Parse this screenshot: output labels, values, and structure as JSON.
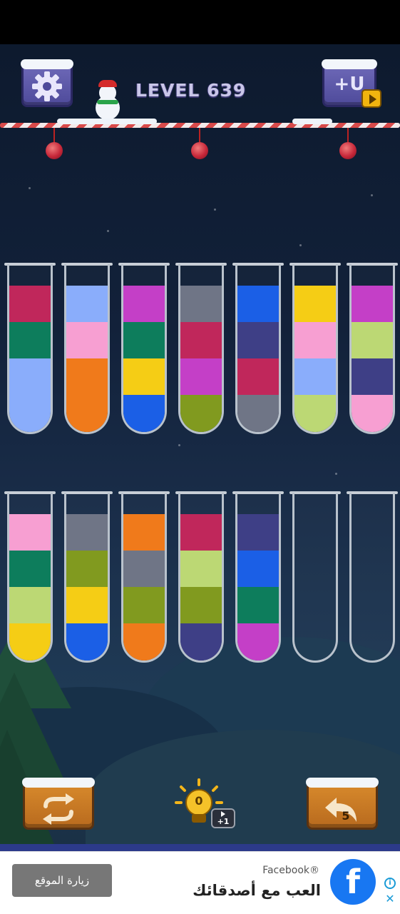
{
  "header": {
    "level_label": "LEVEL 639",
    "settings_icon": "gear-icon",
    "add_tube_icon": "add-tube-icon",
    "add_tube_label": "+U",
    "video_ad_icon": "play-icon"
  },
  "colors": {
    "crimson": "#c0275b",
    "teal": "#0d7d5c",
    "light_blue": "#8aadfb",
    "pink": "#f79fd2",
    "orange": "#f07a1b",
    "magenta": "#c43fc7",
    "yellow": "#f5cd15",
    "blue": "#1b5fe6",
    "gray": "#6f7586",
    "olive": "#819a1f",
    "navy": "#3e3f86",
    "lime": "#bcd874"
  },
  "tubes": [
    {
      "id": 1,
      "balls": [
        "crimson",
        "teal",
        "light_blue",
        "light_blue"
      ]
    },
    {
      "id": 2,
      "balls": [
        "light_blue",
        "pink",
        "orange",
        "orange"
      ]
    },
    {
      "id": 3,
      "balls": [
        "magenta",
        "teal",
        "yellow",
        "blue"
      ]
    },
    {
      "id": 4,
      "balls": [
        "gray",
        "crimson",
        "magenta",
        "olive"
      ]
    },
    {
      "id": 5,
      "balls": [
        "blue",
        "navy",
        "crimson",
        "gray"
      ]
    },
    {
      "id": 6,
      "balls": [
        "yellow",
        "pink",
        "light_blue",
        "lime"
      ]
    },
    {
      "id": 7,
      "balls": [
        "magenta",
        "lime",
        "navy",
        "pink"
      ]
    },
    {
      "id": 8,
      "balls": [
        "pink",
        "teal",
        "lime",
        "yellow"
      ]
    },
    {
      "id": 9,
      "balls": [
        "gray",
        "olive",
        "yellow",
        "blue"
      ]
    },
    {
      "id": 10,
      "balls": [
        "orange",
        "gray",
        "olive",
        "orange"
      ]
    },
    {
      "id": 11,
      "balls": [
        "crimson",
        "lime",
        "olive",
        "navy"
      ]
    },
    {
      "id": 12,
      "balls": [
        "navy",
        "blue",
        "teal",
        "magenta"
      ]
    },
    {
      "id": 13,
      "balls": []
    },
    {
      "id": 14,
      "balls": []
    }
  ],
  "controls": {
    "restart_icon": "restart-icon",
    "hint_icon": "lightbulb-icon",
    "hint_count": "0",
    "hint_bonus_label": "+1",
    "undo_icon": "undo-icon",
    "undo_count": "5"
  },
  "ad": {
    "visit_button": "زيارة الموقع",
    "brand": "Facebook®",
    "headline": "العب مع أصدقائك",
    "logo_letter": "f",
    "info_icon": "info-icon",
    "close_icon": "close-icon"
  }
}
